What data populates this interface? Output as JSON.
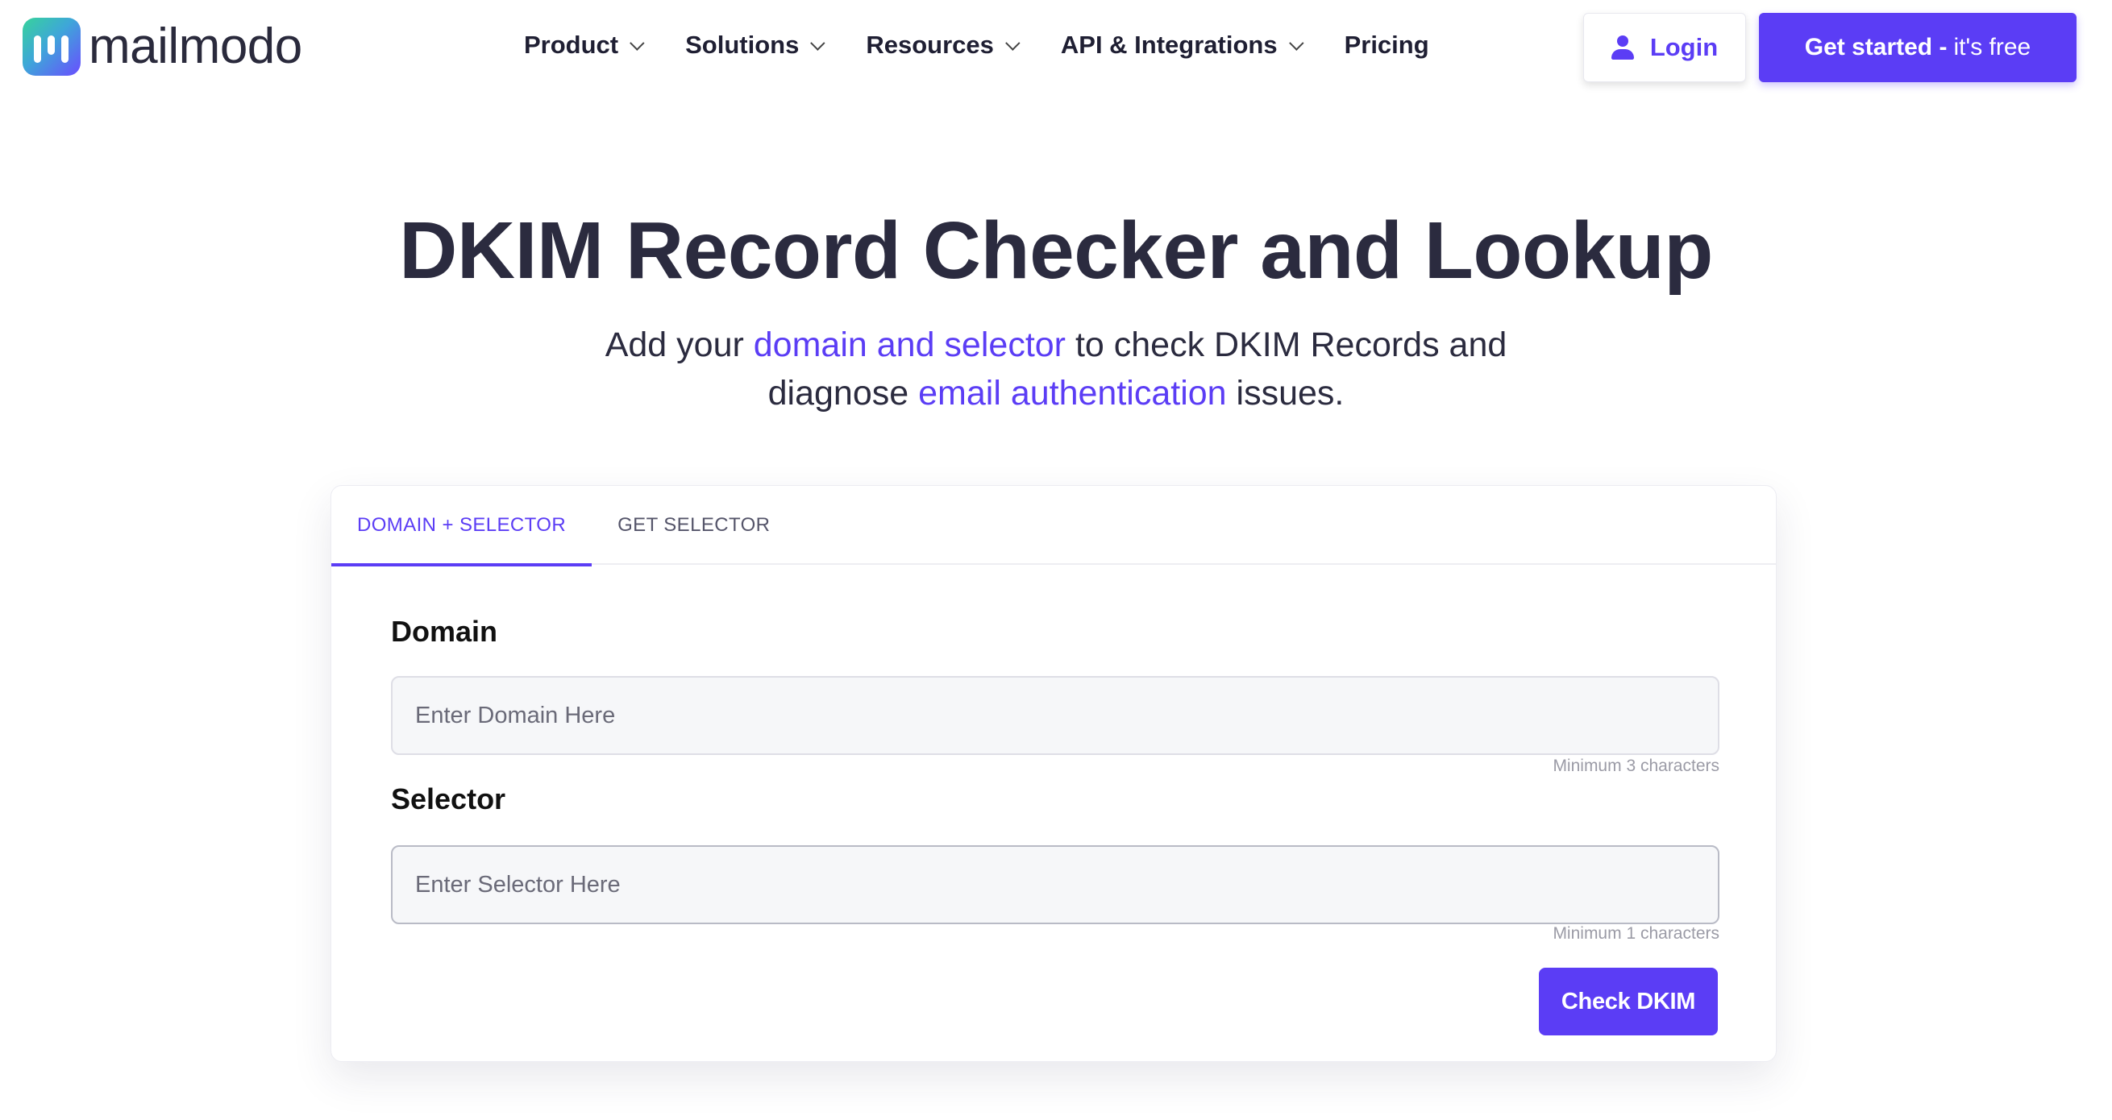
{
  "brand": {
    "name": "mailmodo",
    "logo_icon": "mailmodo-logo-icon",
    "accent": "#5b3df5"
  },
  "nav": {
    "items": [
      {
        "label": "Product",
        "has_dropdown": true
      },
      {
        "label": "Solutions",
        "has_dropdown": true
      },
      {
        "label": "Resources",
        "has_dropdown": true
      },
      {
        "label": "API & Integrations",
        "has_dropdown": true
      },
      {
        "label": "Pricing",
        "has_dropdown": false
      }
    ],
    "login_label": "Login",
    "cta_strong": "Get started -",
    "cta_light": "it's free"
  },
  "hero": {
    "title": "DKIM Record Checker and Lookup",
    "sub_1": "Add your ",
    "sub_link_1": "domain and selector",
    "sub_2": " to check DKIM Records and diagnose ",
    "sub_link_2": "email authentication",
    "sub_3": " issues."
  },
  "card": {
    "tabs": [
      {
        "label": "DOMAIN + SELECTOR",
        "active": true
      },
      {
        "label": "GET SELECTOR",
        "active": false
      }
    ],
    "domain": {
      "label": "Domain",
      "placeholder": "Enter Domain Here",
      "value": "",
      "hint": "Minimum 3 characters"
    },
    "selector": {
      "label": "Selector",
      "placeholder": "Enter Selector Here",
      "value": "",
      "hint": "Minimum 1 characters"
    },
    "submit_label": "Check DKIM"
  }
}
